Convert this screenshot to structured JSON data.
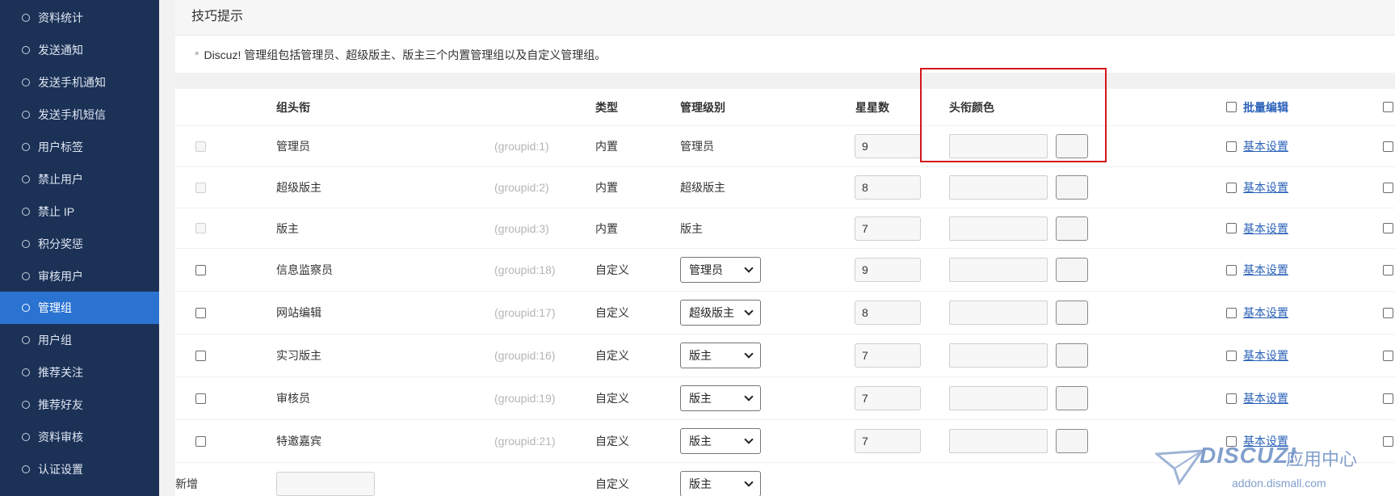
{
  "sidebar": {
    "items": [
      {
        "label": "资料统计"
      },
      {
        "label": "发送通知"
      },
      {
        "label": "发送手机通知"
      },
      {
        "label": "发送手机短信"
      },
      {
        "label": "用户标签"
      },
      {
        "label": "禁止用户"
      },
      {
        "label": "禁止 IP"
      },
      {
        "label": "积分奖惩"
      },
      {
        "label": "审核用户"
      },
      {
        "label": "管理组",
        "active": true
      },
      {
        "label": "用户组"
      },
      {
        "label": "推荐关注"
      },
      {
        "label": "推荐好友"
      },
      {
        "label": "资料审核"
      },
      {
        "label": "认证设置"
      }
    ]
  },
  "tips": {
    "title": "技巧提示",
    "text": "Discuz! 管理组包括管理员、超级版主、版主三个内置管理组以及自定义管理组。"
  },
  "table": {
    "headers": {
      "group_title": "组头衔",
      "type": "类型",
      "level": "管理级别",
      "stars": "星星数",
      "title_color": "头衔颜色",
      "batch_edit": "批量编辑"
    },
    "rows": [
      {
        "name": "管理员",
        "gid": "(groupid:1)",
        "type": "内置",
        "level": "管理员",
        "level_is_select": false,
        "stars": "9",
        "checkbox_disabled": true,
        "action": "基本设置"
      },
      {
        "name": "超级版主",
        "gid": "(groupid:2)",
        "type": "内置",
        "level": "超级版主",
        "level_is_select": false,
        "stars": "8",
        "checkbox_disabled": true,
        "action": "基本设置"
      },
      {
        "name": "版主",
        "gid": "(groupid:3)",
        "type": "内置",
        "level": "版主",
        "level_is_select": false,
        "stars": "7",
        "checkbox_disabled": true,
        "action": "基本设置"
      },
      {
        "name": "信息监察员",
        "gid": "(groupid:18)",
        "type": "自定义",
        "level": "管理员",
        "level_is_select": true,
        "stars": "9",
        "checkbox_disabled": false,
        "action": "基本设置"
      },
      {
        "name": "网站编辑",
        "gid": "(groupid:17)",
        "type": "自定义",
        "level": "超级版主",
        "level_is_select": true,
        "stars": "8",
        "checkbox_disabled": false,
        "action": "基本设置"
      },
      {
        "name": "实习版主",
        "gid": "(groupid:16)",
        "type": "自定义",
        "level": "版主",
        "level_is_select": true,
        "stars": "7",
        "checkbox_disabled": false,
        "action": "基本设置"
      },
      {
        "name": "审核员",
        "gid": "(groupid:19)",
        "type": "自定义",
        "level": "版主",
        "level_is_select": true,
        "stars": "7",
        "checkbox_disabled": false,
        "action": "基本设置"
      },
      {
        "name": "特邀嘉宾",
        "gid": "(groupid:21)",
        "type": "自定义",
        "level": "版主",
        "level_is_select": true,
        "stars": "7",
        "checkbox_disabled": false,
        "action": "基本设置"
      }
    ],
    "new_row": {
      "label": "新增",
      "type": "自定义",
      "level": "版主"
    }
  },
  "watermark": {
    "brand": "DISCUZ!",
    "cn": "应用中心",
    "url": "addon.dismall.com"
  },
  "colors": {
    "sidebar_bg": "#1b3156",
    "sidebar_active": "#2a73d1",
    "link": "#2b62b8",
    "highlight_border": "#d4161a"
  }
}
